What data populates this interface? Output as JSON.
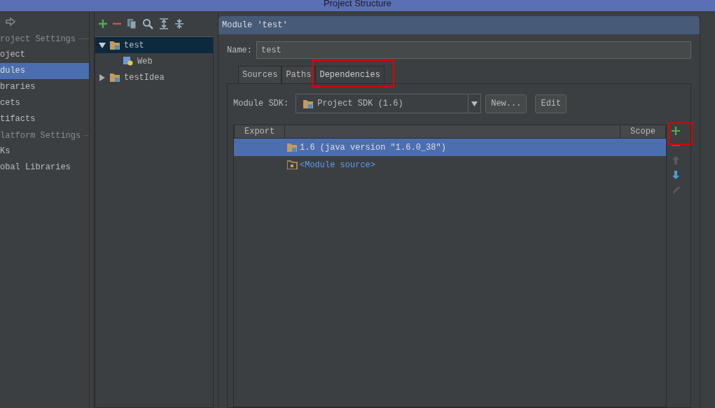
{
  "window": {
    "title": "Project Structure"
  },
  "sidebar": {
    "items": [
      {
        "kind": "header",
        "label": "roject Settings"
      },
      {
        "kind": "item",
        "label": "oject",
        "selected": false
      },
      {
        "kind": "item",
        "label": "dules",
        "selected": true
      },
      {
        "kind": "item",
        "label": "braries",
        "selected": false
      },
      {
        "kind": "item",
        "label": "cets",
        "selected": false
      },
      {
        "kind": "item",
        "label": "tifacts",
        "selected": false
      },
      {
        "kind": "header",
        "label": "latform Settings"
      },
      {
        "kind": "item",
        "label": "Ks",
        "selected": false
      },
      {
        "kind": "item",
        "label": "obal Libraries",
        "selected": false
      }
    ]
  },
  "tree": {
    "nodes": [
      {
        "label": "test",
        "expanded": true,
        "selected": true,
        "children": [
          {
            "label": "Web"
          }
        ]
      },
      {
        "label": "testIdea",
        "expanded": false,
        "selected": false
      }
    ]
  },
  "module": {
    "header": "Module 'test'",
    "name_label": "Name:",
    "name_value": "test",
    "tabs": [
      {
        "label": "Sources",
        "selected": false
      },
      {
        "label": "Paths",
        "selected": false
      },
      {
        "label": "Dependencies",
        "selected": true
      }
    ],
    "sdk_label": "Module SDK:",
    "sdk_value": "Project SDK (1.6)",
    "buttons": [
      "New...",
      "Edit"
    ],
    "table": {
      "columns": [
        {
          "label": "Export"
        },
        {
          "label": "Scope"
        }
      ],
      "rows": [
        {
          "kind": "sdk",
          "text": "1.6 (java version \"1.6.0_38\")",
          "selected": true
        },
        {
          "kind": "source",
          "text": "<Module source>",
          "selected": false
        }
      ]
    },
    "tools": [
      {
        "kind": "add",
        "disabled": false
      },
      {
        "kind": "remove",
        "disabled": true
      },
      {
        "kind": "up",
        "disabled": true
      },
      {
        "kind": "down",
        "disabled": false
      },
      {
        "kind": "edit",
        "disabled": true
      }
    ]
  }
}
